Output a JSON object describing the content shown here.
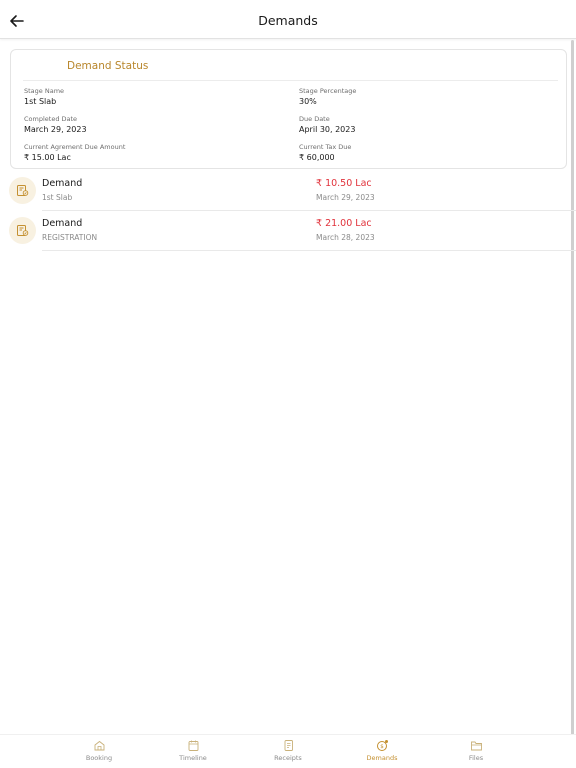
{
  "header": {
    "title": "Demands"
  },
  "status_card": {
    "title": "Demand Status",
    "fields": [
      {
        "label": "Stage Name",
        "value": "1st Slab"
      },
      {
        "label": "Stage Percentage",
        "value": "30%"
      },
      {
        "label": "Completed Date",
        "value": "March 29, 2023"
      },
      {
        "label": "Due Date",
        "value": "April 30, 2023"
      },
      {
        "label": "Current Agrement Due Amount",
        "value": "₹ 15.00 Lac"
      },
      {
        "label": "Current Tax Due",
        "value": "₹ 60,000"
      }
    ]
  },
  "demands": [
    {
      "title": "Demand",
      "subtitle": "1st Slab",
      "amount": "₹ 10.50 Lac",
      "date": "March 29, 2023"
    },
    {
      "title": "Demand",
      "subtitle": "REGISTRATION",
      "amount": "₹ 21.00 Lac",
      "date": "March 28, 2023"
    }
  ],
  "bottom_nav": {
    "items": [
      {
        "label": "Booking",
        "icon": "booking-icon"
      },
      {
        "label": "Timeline",
        "icon": "timeline-icon"
      },
      {
        "label": "Receipts",
        "icon": "receipts-icon"
      },
      {
        "label": "Demands",
        "icon": "demands-icon",
        "active": true
      },
      {
        "label": "Files",
        "icon": "files-icon"
      }
    ]
  },
  "colors": {
    "accent": "#b8862b",
    "amount": "#e1323b",
    "icon_bg": "#f8f1e1",
    "muted": "#8a8a8a"
  }
}
